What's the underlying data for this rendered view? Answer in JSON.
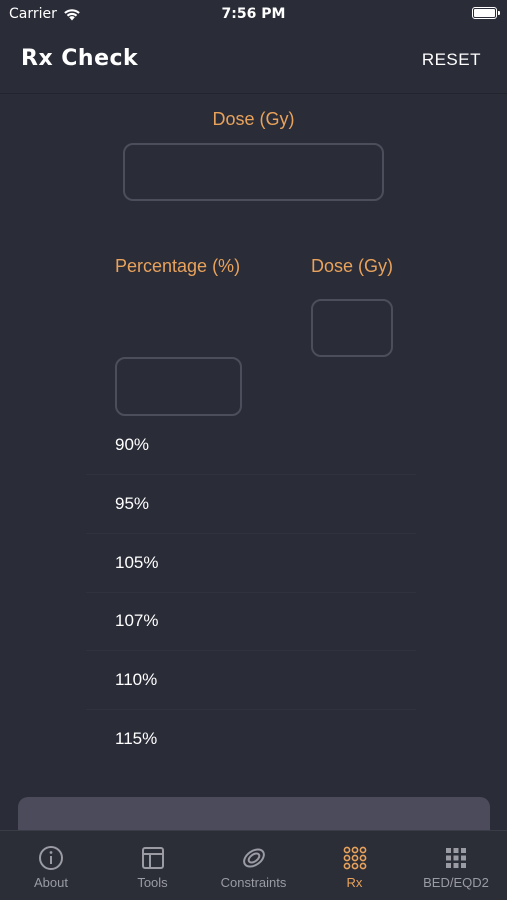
{
  "status": {
    "carrier": "Carrier",
    "time": "7:56 PM"
  },
  "nav": {
    "title": "Rx Check",
    "reset": "RESET"
  },
  "form": {
    "dose_label": "Dose (Gy)",
    "percentage_label": "Percentage (%)",
    "dose_label_2": "Dose (Gy)"
  },
  "percentages": [
    "90%",
    "95%",
    "105%",
    "107%",
    "110%",
    "115%"
  ],
  "tabs": [
    {
      "label": "About",
      "icon": "info-icon"
    },
    {
      "label": "Tools",
      "icon": "tools-icon"
    },
    {
      "label": "Constraints",
      "icon": "constraints-icon"
    },
    {
      "label": "Rx",
      "icon": "rx-grid-icon"
    },
    {
      "label": "BED/EQD2",
      "icon": "bed-grid-icon"
    }
  ],
  "colors": {
    "accent": "#e8a25c",
    "background": "#2a2c37",
    "inactive": "#9a9ba3"
  }
}
